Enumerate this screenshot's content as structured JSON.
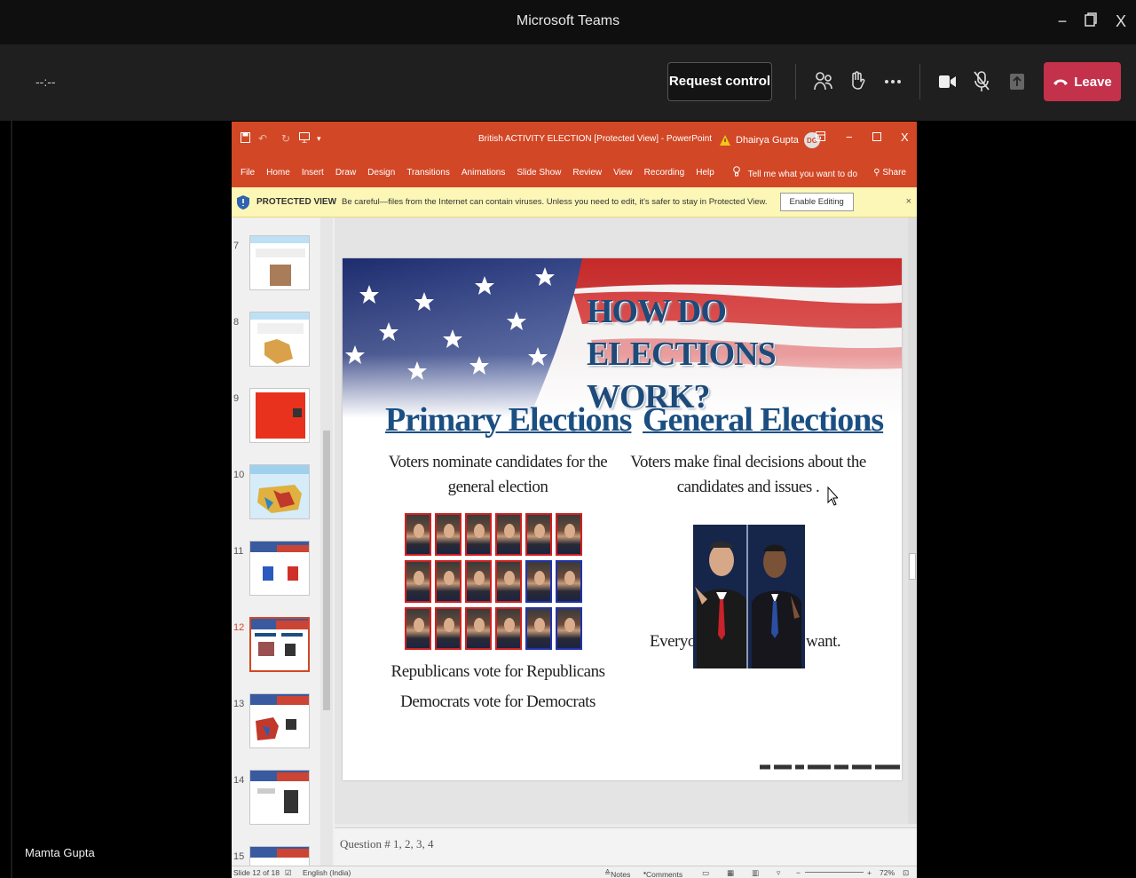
{
  "teams": {
    "title": "Microsoft Teams",
    "timer": "--:--",
    "request_control": "Request control",
    "leave": "Leave",
    "presenter": "Mamta Gupta"
  },
  "ppt": {
    "doc_title": "British ACTIVITY ELECTION [Protected View]  -  PowerPoint",
    "user_name": "Dhairya Gupta",
    "user_initials": "DG",
    "ribbon_tabs": [
      "File",
      "Home",
      "Insert",
      "Draw",
      "Design",
      "Transitions",
      "Animations",
      "Slide Show",
      "Review",
      "View",
      "Recording",
      "Help"
    ],
    "tell_me": "Tell me what you want to do",
    "share": "Share",
    "protected_label": "PROTECTED VIEW",
    "protected_msg": "Be careful—files from the Internet can contain viruses. Unless you need to edit, it's safer to stay in Protected View.",
    "enable_editing": "Enable Editing",
    "thumb_numbers": [
      "7",
      "8",
      "9",
      "10",
      "11",
      "12",
      "13",
      "14",
      "15"
    ],
    "notes": "Question # 1, 2, 3, 4",
    "status_slide": "Slide 12 of 18",
    "status_lang": "English (India)",
    "status_notes": "Notes",
    "status_comments": "Comments",
    "zoom": "72%"
  },
  "slide": {
    "title_line1": "HOW DO ELECTIONS",
    "title_line2": "WORK?",
    "primary_heading": "Primary Elections",
    "primary_line1": "Voters nominate candidates for the",
    "primary_line2": "general election",
    "general_heading": "General Elections",
    "general_line1": "Voters make final decisions about the",
    "general_line2": "candidates and issues .",
    "rep_line": "Republicans vote for Republicans",
    "dem_line": "Democrats vote for Democrats",
    "everyone_left": "Everyon",
    "everyone_right": "want."
  },
  "colors": {
    "teams_leave": "#c4314b",
    "ppt_orange": "#d24726",
    "slide_heading_blue": "#1b4f82"
  }
}
